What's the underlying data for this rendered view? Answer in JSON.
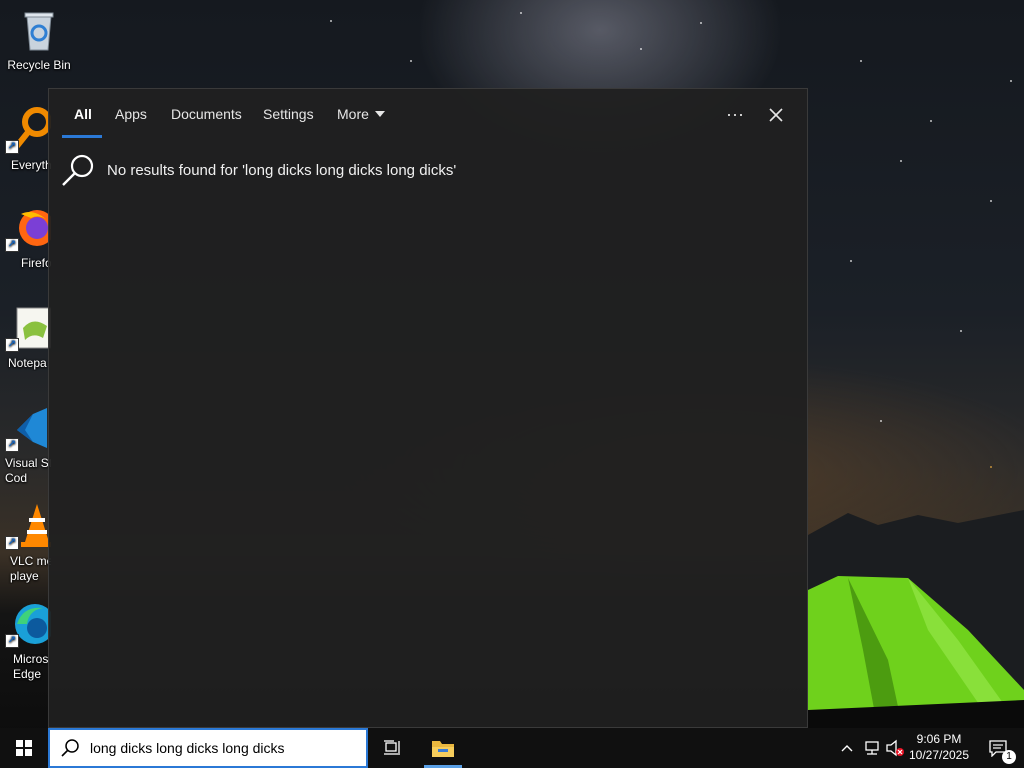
{
  "desktop": {
    "icons": [
      {
        "id": "recycle-bin",
        "label": "Recycle Bin",
        "icon": "recycle-bin-icon"
      },
      {
        "id": "everything",
        "label": "Everyth",
        "icon": "everything-icon"
      },
      {
        "id": "firefox",
        "label": "Firefo",
        "icon": "firefox-icon"
      },
      {
        "id": "notepad",
        "label": "Notepa",
        "icon": "notepad-plus-plus-icon"
      },
      {
        "id": "vscode",
        "label": "Visual St\nCod",
        "icon": "vscode-icon"
      },
      {
        "id": "vlc",
        "label": "VLC me\nplaye",
        "icon": "vlc-icon"
      },
      {
        "id": "edge",
        "label": "Micros\nEdge",
        "icon": "edge-icon"
      }
    ]
  },
  "search_panel": {
    "tabs": [
      {
        "label": "All",
        "active": true
      },
      {
        "label": "Apps",
        "active": false
      },
      {
        "label": "Documents",
        "active": false
      },
      {
        "label": "Settings",
        "active": false
      },
      {
        "label": "More",
        "active": false
      }
    ],
    "options_label": "···",
    "no_results_text": "No results found for 'long dicks long dicks long dicks'"
  },
  "taskbar": {
    "search_value": "long dicks long dicks long dicks",
    "clock_time": "9:06 PM",
    "clock_date": "10/27/2025",
    "notification_count": "1"
  },
  "colors": {
    "accent": "#2b79d6",
    "panel_bg": "#202020",
    "taskbar_bg": "#101010"
  }
}
